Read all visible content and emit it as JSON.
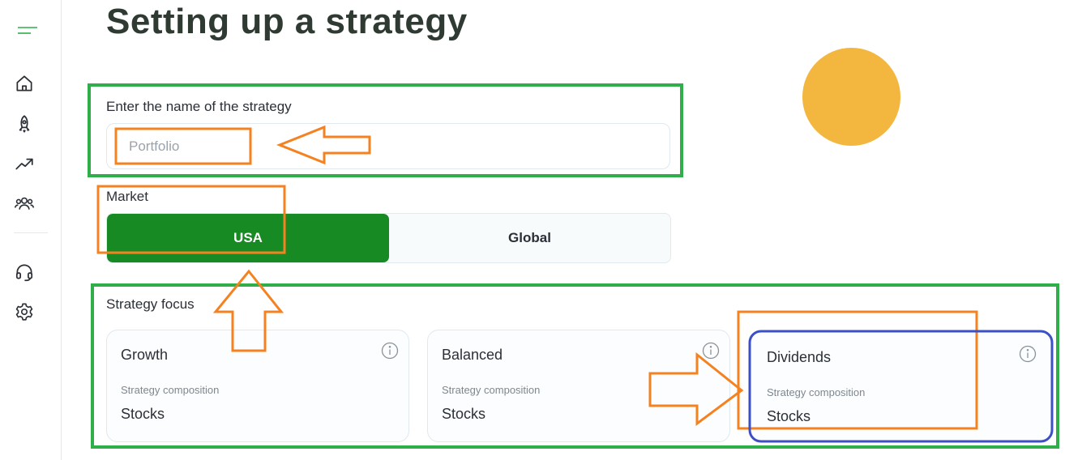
{
  "page": {
    "title": "Setting up a strategy"
  },
  "name_field": {
    "label": "Enter the name of the strategy",
    "placeholder": "Portfolio"
  },
  "market": {
    "label": "Market",
    "options": [
      "USA",
      "Global"
    ],
    "selected": "USA"
  },
  "focus": {
    "label": "Strategy focus",
    "cards": [
      {
        "title": "Growth",
        "subtitle": "Strategy composition",
        "value": "Stocks"
      },
      {
        "title": "Balanced",
        "subtitle": "Strategy composition",
        "value": "Stocks"
      },
      {
        "title": "Dividends",
        "subtitle": "Strategy composition",
        "value": "Stocks"
      }
    ],
    "selected": "Dividends"
  },
  "sidebar": {
    "icons": [
      "menu-icon",
      "home-icon",
      "rocket-icon",
      "trending-up-icon",
      "users-icon",
      "headset-icon",
      "settings-icon"
    ]
  },
  "colors": {
    "accent_green": "#178a23",
    "decor_yellow": "#f3b63f",
    "annotation_orange": "#f58220",
    "annotation_green": "#2fae4a",
    "annotation_blue": "#3c4fc4"
  }
}
